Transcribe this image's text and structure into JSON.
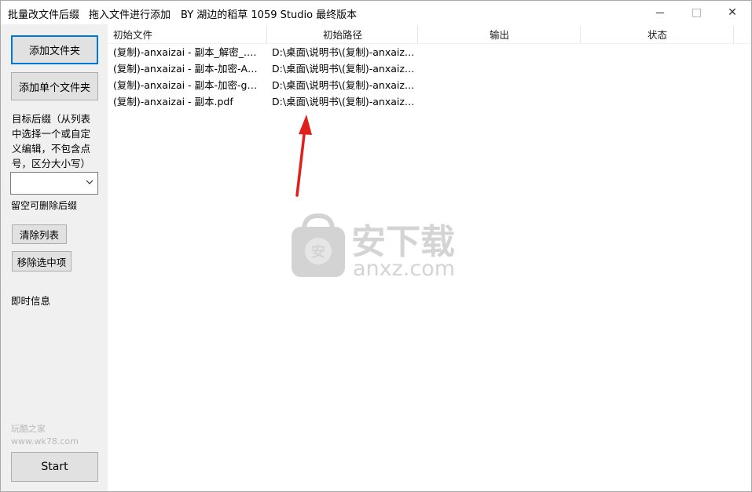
{
  "titlebar": {
    "title_main": "批量改文件后缀",
    "title_drag": "拖入文件进行添加",
    "title_author": "BY 湖边的稻草 1059 Studio 最终版本",
    "min_icon": "minimize-icon",
    "max_icon": "maximize-icon",
    "close_glyph": "✕"
  },
  "left": {
    "add_folder": "添加文件夹",
    "add_file": "添加单个文件夹",
    "target_desc": "目标后缀（从列表中选择一个或自定义编辑，不包含点号，区分大小写）",
    "suffix_value": "",
    "empty_hint": "留空可删除后缀",
    "clear_list": "清除列表",
    "remove_selected": "移除选中项",
    "info_label": "即时信息",
    "start": "Start"
  },
  "watermark_small": {
    "line1": "玩酷之家",
    "line2": "www.wk78.com"
  },
  "watermark_logo": {
    "cn": "安下载",
    "en": "anxz.com",
    "badge": "安"
  },
  "list": {
    "columns": [
      "初始文件",
      "初始路径",
      "输出",
      "状态"
    ],
    "rows": [
      {
        "file": "(复制)-anxaizai - 副本_解密_.pdf",
        "path": "D:\\桌面\\说明书\\(复制)-anxaizai...",
        "output": "",
        "status": ""
      },
      {
        "file": "(复制)-anxaizai - 副本-加密-ABC...",
        "path": "D:\\桌面\\说明书\\(复制)-anxaizai...",
        "output": "",
        "status": ""
      },
      {
        "file": "(复制)-anxaizai - 副本-加密-gwxK...",
        "path": "D:\\桌面\\说明书\\(复制)-anxaizai...",
        "output": "",
        "status": ""
      },
      {
        "file": "(复制)-anxaizai - 副本.pdf",
        "path": "D:\\桌面\\说明书\\(复制)-anxaizai...",
        "output": "",
        "status": ""
      }
    ]
  },
  "colors": {
    "accent": "#0078d7",
    "annotation_arrow": "#e0201b",
    "window_bg": "#f0f0f0"
  }
}
